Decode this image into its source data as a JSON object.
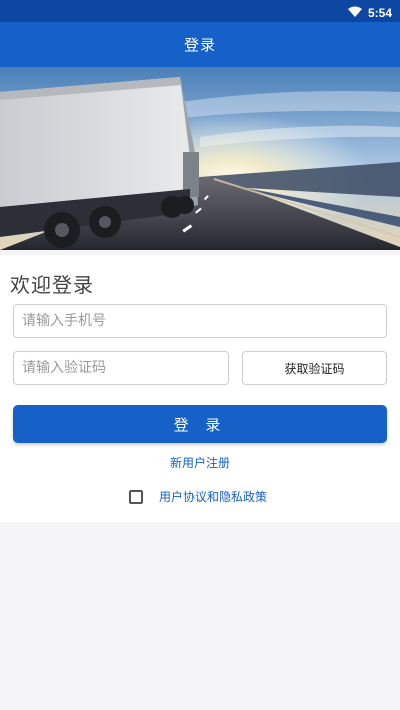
{
  "status_bar": {
    "time": "5:54",
    "wifi_icon": "wifi-icon"
  },
  "header": {
    "title": "登录"
  },
  "hero": {
    "image": "truck-on-highway-sunset"
  },
  "form": {
    "welcome": "欢迎登录",
    "phone_placeholder": "请输入手机号",
    "code_placeholder": "请输入验证码",
    "get_code_label": "获取验证码",
    "login_label": "登 录",
    "register_label": "新用户注册",
    "agreement_label": "用户协议和隐私政策",
    "agreement_checked": false
  },
  "colors": {
    "primary": "#1561c7",
    "status_bar": "#0d47a1",
    "link": "#1561c7"
  }
}
